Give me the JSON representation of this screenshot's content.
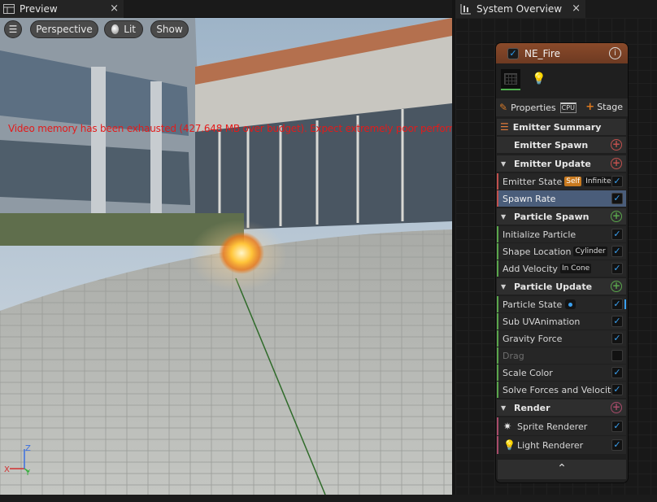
{
  "preview": {
    "tab_title": "Preview",
    "close_glyph": "×",
    "menu_glyph": "☰",
    "perspective_label": "Perspective",
    "lit_label": "Lit",
    "show_label": "Show",
    "warning_text": "Video memory has been exhausted (427.648 MB over budget). Expect extremely poor performance.",
    "axis_labels": {
      "z": "Z",
      "x": "X",
      "y": "Y"
    }
  },
  "system_overview": {
    "tab_title": "System Overview",
    "close_glyph": "×",
    "node": {
      "title": "NE_Fire",
      "enabled_check": "✓",
      "info_glyph": "i",
      "properties_label": "Properties",
      "cpu_badge": "CPU",
      "stage_label": "Stage",
      "summary_label": "Emitter Summary",
      "collapse_glyph": "⌃",
      "sections": {
        "emitter_spawn": "Emitter Spawn",
        "emitter_update": "Emitter Update",
        "particle_spawn": "Particle Spawn",
        "particle_update": "Particle Update",
        "render": "Render"
      },
      "items": {
        "emitter_state": {
          "label": "Emitter State",
          "badge1": "Self",
          "badge2": "Infinite"
        },
        "spawn_rate": {
          "label": "Spawn Rate"
        },
        "initialize_particle": {
          "label": "Initialize Particle"
        },
        "shape_location": {
          "label": "Shape Location",
          "badge": "Cylinder"
        },
        "add_velocity": {
          "label": "Add Velocity",
          "badge": "In Cone"
        },
        "particle_state": {
          "label": "Particle State"
        },
        "sub_uv_animation": {
          "label": "Sub UVAnimation"
        },
        "gravity_force": {
          "label": "Gravity Force"
        },
        "drag": {
          "label": "Drag"
        },
        "scale_color": {
          "label": "Scale Color"
        },
        "solve_forces": {
          "label": "Solve Forces and Velocity"
        },
        "sprite_renderer": {
          "label": "Sprite Renderer"
        },
        "light_renderer": {
          "label": "Light Renderer"
        }
      }
    }
  },
  "colors": {
    "emitter_accent": "#c0504d",
    "particle_accent": "#5aa64c",
    "render_accent": "#a84b6a",
    "checkbox_blue": "#3aa0f0",
    "warning_red": "#e21b1b",
    "selected_row": "#4a5d7a"
  }
}
